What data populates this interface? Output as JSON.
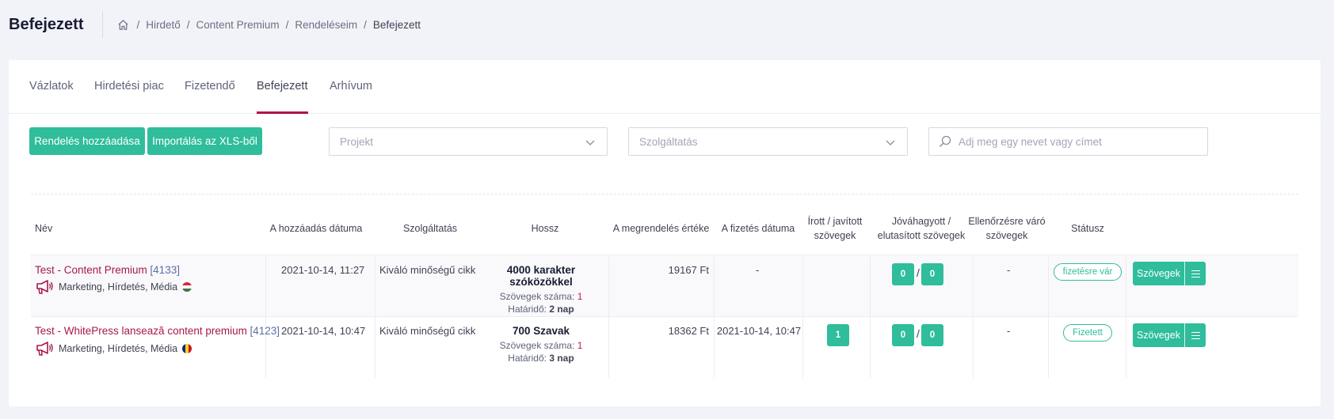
{
  "header": {
    "title": "Befejezett",
    "breadcrumb": [
      "Hirdető",
      "Content Premium",
      "Rendeléseim",
      "Befejezett"
    ],
    "home_icon": "home-icon"
  },
  "tabs": [
    {
      "label": "Vázlatok",
      "active": false
    },
    {
      "label": "Hirdetési piac",
      "active": false
    },
    {
      "label": "Fizetendő",
      "active": false
    },
    {
      "label": "Befejezett",
      "active": true
    },
    {
      "label": "Arhívum",
      "active": false
    }
  ],
  "toolbar": {
    "add_order_label": "Rendelés hozzáadása",
    "import_label": "Importálás az XLS-ből",
    "project_placeholder": "Projekt",
    "service_placeholder": "Szolgáltatás",
    "search_placeholder": "Adj meg egy nevet vagy címet"
  },
  "table": {
    "headers": {
      "name": "Név",
      "added": "A hozzáadás dátuma",
      "service": "Szolgáltatás",
      "length": "Hossz",
      "value": "A megrendelés értéke",
      "paid": "A fizetés dátuma",
      "written": "Írott / javított szövegek",
      "approved": "Jóváhagyott / elutasított szövegek",
      "pending": "Ellenőrzésre váró szövegek",
      "status": "Státusz"
    },
    "rows": [
      {
        "name": "Test - Content Premium",
        "id": "[4133]",
        "category": "Marketing, Hírdetés, Média",
        "flag": "hu",
        "added": "2021-10-14, 11:27",
        "service": "Kiváló minőségű cikk",
        "length_main": "4000 karakter szóközökkel",
        "texts_label": "Szövegek száma:",
        "texts_count": "1",
        "deadline_label": "Határidő:",
        "deadline": "2 nap",
        "value": "19167 Ft",
        "paid": "-",
        "written": "",
        "approved": "0",
        "rejected": "0",
        "pending": "-",
        "status": "fizetésre vár",
        "texts_button": "Szövegek"
      },
      {
        "name": "Test - WhitePress lansează content premium",
        "id": "[4123]",
        "category": "Marketing, Hírdetés, Média",
        "flag": "ro",
        "added": "2021-10-14, 10:47",
        "service": "Kiváló minőségű cikk",
        "length_main": "700 Szavak",
        "texts_label": "Szövegek száma:",
        "texts_count": "1",
        "deadline_label": "Határidő:",
        "deadline": "3 nap",
        "value": "18362 Ft",
        "paid": "2021-10-14, 10:47",
        "written": "1",
        "approved": "0",
        "rejected": "0",
        "pending": "-",
        "status": "Fizetett",
        "texts_button": "Szövegek"
      }
    ]
  },
  "colors": {
    "accent": "#2fbd9b",
    "brand": "#b0144e",
    "link": "#a8184b"
  }
}
